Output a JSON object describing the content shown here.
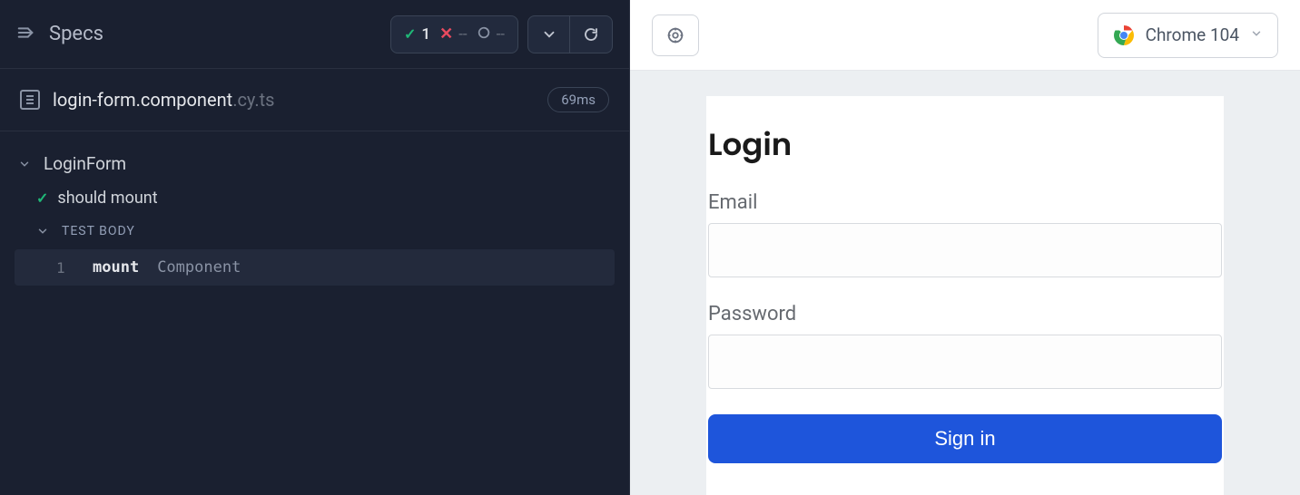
{
  "header": {
    "specs_label": "Specs",
    "pass_count": "1",
    "fail_count": "--",
    "pending_count": "--"
  },
  "spec_file": {
    "name": "login-form.component",
    "ext": ".cy.ts",
    "duration": "69ms"
  },
  "suite": {
    "name": "LoginForm",
    "test_name": "should mount",
    "body_label": "TEST BODY",
    "commands": [
      {
        "num": "1",
        "name": "mount",
        "arg": "Component"
      }
    ]
  },
  "preview": {
    "browser": "Chrome 104"
  },
  "login": {
    "title": "Login",
    "email_label": "Email",
    "password_label": "Password",
    "signin": "Sign in"
  }
}
